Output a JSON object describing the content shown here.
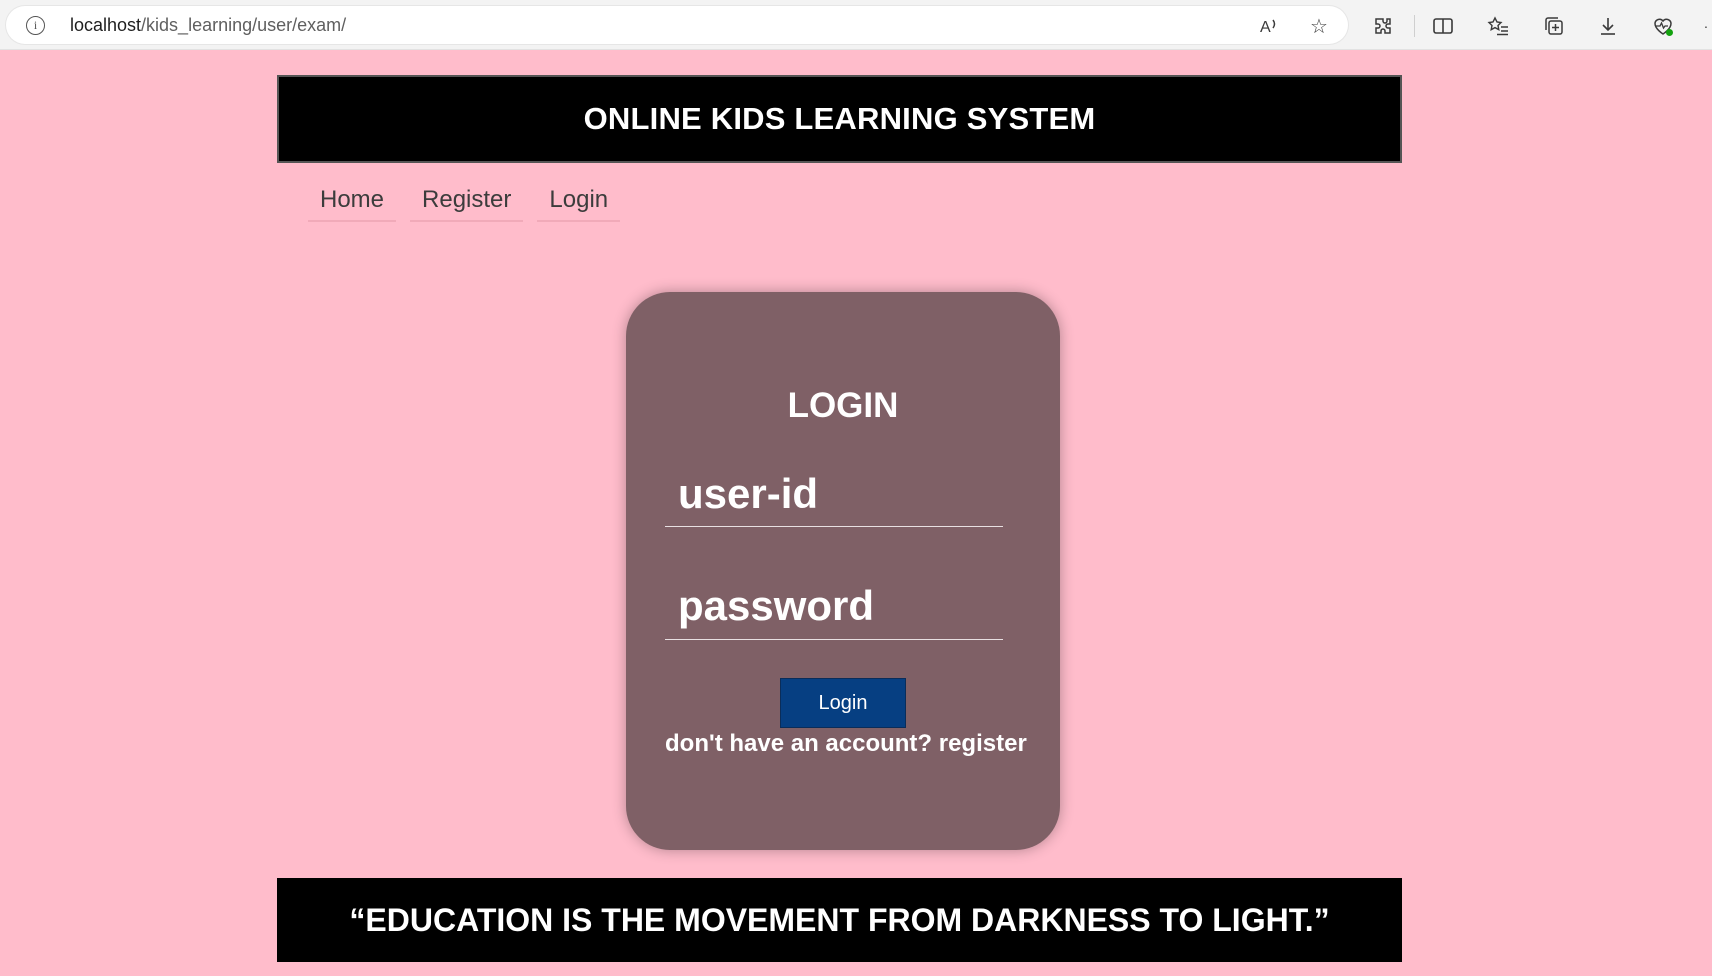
{
  "browser": {
    "url_host": "localhost",
    "url_path": "/kids_learning/user/exam/",
    "icons": [
      "info-icon",
      "read-aloud-icon",
      "favorite-star-icon",
      "extensions-icon",
      "split-screen-icon",
      "favorites-list-icon",
      "collections-icon",
      "downloads-icon",
      "browser-health-icon",
      "more-icon"
    ]
  },
  "header": {
    "title": "ONLINE KIDS LEARNING SYSTEM"
  },
  "nav": {
    "home": "Home",
    "register": "Register",
    "login": "Login"
  },
  "login_form": {
    "title": "LOGIN",
    "userid_placeholder": "user-id",
    "password_placeholder": "password",
    "submit_label": "Login",
    "register_prompt": "don't have an account? register"
  },
  "footer": {
    "quote": "“EDUCATION IS THE MOVEMENT FROM DARKNESS TO LIGHT.”"
  },
  "colors": {
    "page_bg": "#ffbccb",
    "card_bg": "#7f6066",
    "banner_bg": "#000000",
    "button_bg": "#063f82"
  }
}
